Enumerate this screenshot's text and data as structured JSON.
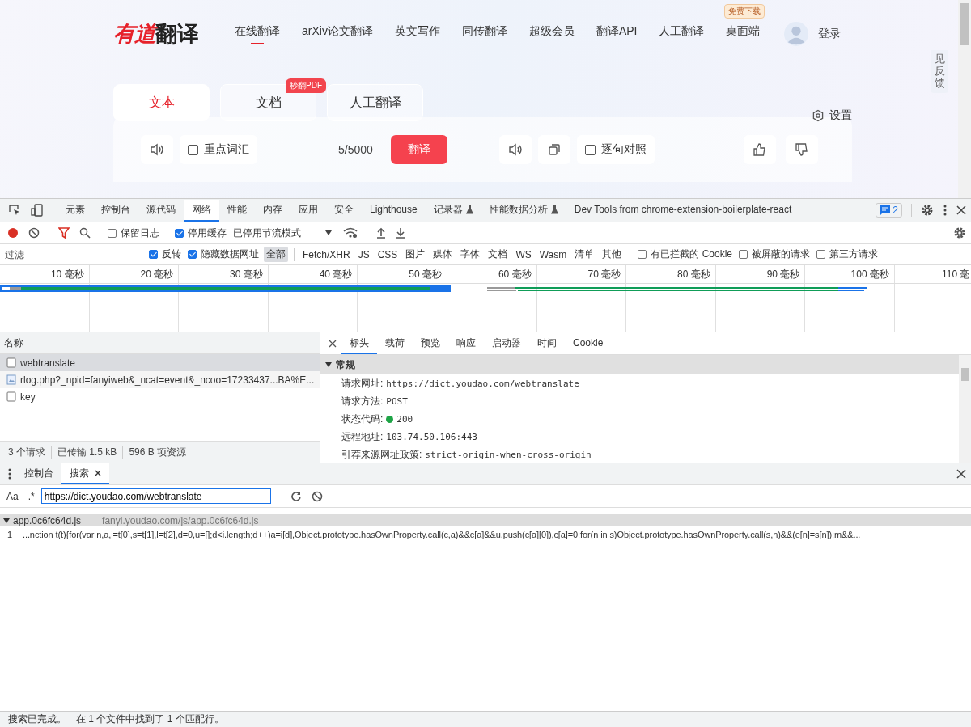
{
  "site": {
    "logo": {
      "mark": "有道",
      "text": "翻译"
    },
    "nav": [
      {
        "label": "在线翻译",
        "selected": true
      },
      {
        "label": "arXiv论文翻译",
        "selected": false
      },
      {
        "label": "英文写作",
        "selected": false
      },
      {
        "label": "同传翻译",
        "selected": false
      },
      {
        "label": "超级会员",
        "selected": false
      },
      {
        "label": "翻译API",
        "selected": false
      },
      {
        "label": "人工翻译",
        "selected": false
      },
      {
        "label": "桌面端",
        "selected": false,
        "badge": "免费下载"
      }
    ],
    "login": "登录",
    "feedback": "见反馈",
    "modes": [
      {
        "label": "文本",
        "selected": true
      },
      {
        "label": "文档",
        "selected": false,
        "badge": "秒翻PDF"
      },
      {
        "label": "人工翻译",
        "selected": false
      }
    ],
    "settings": "设置",
    "toolbar": {
      "key_words": {
        "label": "重点词汇",
        "checked": false
      },
      "count": "5/5000",
      "translate": "翻译",
      "sentence_compare": {
        "label": "逐句对照",
        "checked": false
      }
    }
  },
  "devtools": {
    "tabs": [
      {
        "label": "元素",
        "selected": false,
        "experimental": false
      },
      {
        "label": "控制台",
        "selected": false,
        "experimental": false
      },
      {
        "label": "源代码",
        "selected": false,
        "experimental": false
      },
      {
        "label": "网络",
        "selected": true,
        "experimental": false
      },
      {
        "label": "性能",
        "selected": false,
        "experimental": false
      },
      {
        "label": "内存",
        "selected": false,
        "experimental": false
      },
      {
        "label": "应用",
        "selected": false,
        "experimental": false
      },
      {
        "label": "安全",
        "selected": false,
        "experimental": false
      },
      {
        "label": "Lighthouse",
        "selected": false,
        "experimental": false
      },
      {
        "label": "记录器",
        "selected": false,
        "experimental": true
      },
      {
        "label": "性能数据分析",
        "selected": false,
        "experimental": true
      },
      {
        "label": "Dev Tools from chrome-extension-boilerplate-react",
        "selected": false,
        "experimental": false
      }
    ],
    "issues_count": "2",
    "network_toolbar": {
      "recording": true,
      "filter_active": true,
      "preserve_log": {
        "label": "保留日志",
        "checked": false
      },
      "disable_cache": {
        "label": "停用缓存",
        "checked": true
      },
      "throttling": "已停用节流模式"
    },
    "filter": {
      "placeholder": "过滤",
      "invert": {
        "label": "反转",
        "checked": true
      },
      "hide_data_urls": {
        "label": "隐藏数据网址",
        "checked": true
      },
      "types": [
        {
          "label": "全部",
          "selected": true
        },
        {
          "label": "Fetch/XHR",
          "selected": false
        },
        {
          "label": "JS",
          "selected": false
        },
        {
          "label": "CSS",
          "selected": false
        },
        {
          "label": "图片",
          "selected": false
        },
        {
          "label": "媒体",
          "selected": false
        },
        {
          "label": "字体",
          "selected": false
        },
        {
          "label": "文档",
          "selected": false
        },
        {
          "label": "WS",
          "selected": false
        },
        {
          "label": "Wasm",
          "selected": false
        },
        {
          "label": "清单",
          "selected": false
        },
        {
          "label": "其他",
          "selected": false
        }
      ],
      "options": [
        {
          "label": "有已拦截的 Cookie",
          "checked": false
        },
        {
          "label": "被屏蔽的请求",
          "checked": false
        },
        {
          "label": "第三方请求",
          "checked": false
        }
      ]
    },
    "timeline": {
      "ticks": [
        "10 毫秒",
        "20 毫秒",
        "30 毫秒",
        "40 毫秒",
        "50 毫秒",
        "60 毫秒",
        "70 毫秒",
        "80 毫秒",
        "90 毫秒",
        "100 毫秒",
        "110 毫"
      ]
    },
    "requests": {
      "header": "名称",
      "rows": [
        {
          "name": "webtranslate",
          "selected": true,
          "kind": "fetch"
        },
        {
          "name": "rlog.php?_npid=fanyiweb&_ncat=event&_ncoo=17233437...BA%E...",
          "selected": false,
          "kind": "image"
        },
        {
          "name": "key",
          "selected": false,
          "kind": "fetch"
        }
      ],
      "summary": [
        "3 个请求",
        "已传输 1.5 kB",
        "596 B 项资源"
      ]
    },
    "details": {
      "tabs": [
        {
          "label": "标头",
          "selected": true
        },
        {
          "label": "载荷",
          "selected": false
        },
        {
          "label": "预览",
          "selected": false
        },
        {
          "label": "响应",
          "selected": false
        },
        {
          "label": "启动器",
          "selected": false
        },
        {
          "label": "时间",
          "selected": false
        },
        {
          "label": "Cookie",
          "selected": false
        }
      ],
      "section": {
        "title": "常规",
        "expanded": true,
        "rows": [
          {
            "label": "请求网址:",
            "value": "https://dict.youdao.com/webtranslate"
          },
          {
            "label": "请求方法:",
            "value": "POST"
          },
          {
            "label": "状态代码:",
            "value": "200",
            "color": "#1ea446"
          },
          {
            "label": "远程地址:",
            "value": "103.74.50.106:443"
          },
          {
            "label": "引荐来源网址政策:",
            "value": "strict-origin-when-cross-origin"
          }
        ]
      }
    }
  },
  "drawer": {
    "tabs": [
      {
        "label": "控制台",
        "selected": false,
        "closable": false
      },
      {
        "label": "搜索",
        "selected": true,
        "closable": true
      }
    ],
    "match_case": "Aa",
    "regex": ".*",
    "query": "https://dict.youdao.com/webtranslate",
    "results": [
      {
        "file": "app.0c6fc64d.js",
        "path": "fanyi.youdao.com/js/app.0c6fc64d.js",
        "expanded": true,
        "matches": [
          {
            "line": "1",
            "text": "...nction t(t){for(var n,a,i=t[0],s=t[1],l=t[2],d=0,u=[];d<i.length;d++)a=i[d],Object.prototype.hasOwnProperty.call(c,a)&&c[a]&&u.push(c[a][0]),c[a]=0;for(n in s)Object.prototype.hasOwnProperty.call(s,n)&&(e[n]=s[n]);m&&..."
          }
        ]
      }
    ],
    "status": [
      "搜索已完成。",
      "在 1 个文件中找到了 1 个匹配行。"
    ]
  }
}
